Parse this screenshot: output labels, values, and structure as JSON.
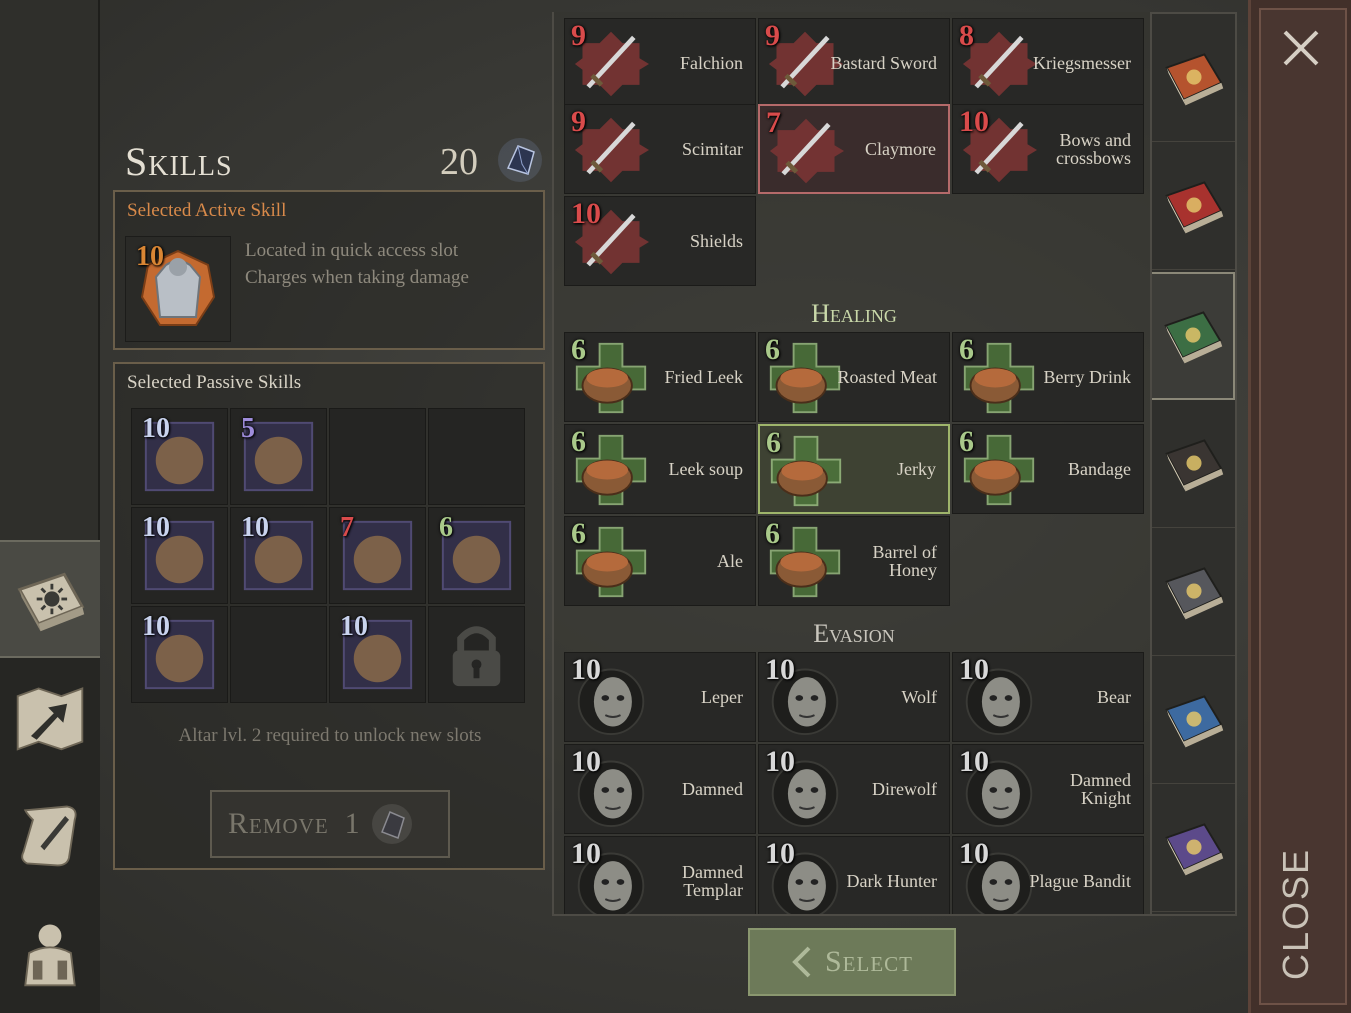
{
  "header": {
    "title": "Skills",
    "points": "20",
    "points_icon": "crystal-gem-icon"
  },
  "active_skill": {
    "title": "Selected Active Skill",
    "level": "10",
    "icon": "armor-torso-icon",
    "lines": [
      "Located in quick access slot",
      "Charges when taking damage"
    ]
  },
  "passive_skills": {
    "title": "Selected Passive Skills",
    "slots": [
      {
        "level": "10",
        "icon": "boot-speed-icon",
        "level_color": "#c9d3ee"
      },
      {
        "level": "5",
        "icon": "demon-shadow-icon",
        "level_color": "#9f8ddc"
      },
      {
        "level": "",
        "icon": "",
        "level_color": ""
      },
      {
        "level": "",
        "icon": "",
        "level_color": ""
      },
      {
        "level": "10",
        "icon": "red-cross-icon",
        "level_color": "#c9d3ee"
      },
      {
        "level": "10",
        "icon": "treasure-map-icon",
        "level_color": "#c9d3ee"
      },
      {
        "level": "7",
        "icon": "claymore-icon",
        "level_color": "#d94b4b"
      },
      {
        "level": "6",
        "icon": "jerky-icon",
        "level_color": "#a9c98a"
      },
      {
        "level": "10",
        "icon": "poison-skull-drop-icon",
        "level_color": "#c9d3ee"
      },
      {
        "level": "",
        "icon": "",
        "level_color": ""
      },
      {
        "level": "10",
        "icon": "chest-armor-icon",
        "level_color": "#c9d3ee"
      },
      {
        "level": "",
        "icon": "padlock-icon",
        "level_color": ""
      }
    ],
    "altar_note": "Altar lvl. 2 required to unlock new slots",
    "remove_label": "Remove",
    "remove_count": "1"
  },
  "weapons": [
    {
      "level": "9",
      "name": "Falchion",
      "icon": "falchion-icon"
    },
    {
      "level": "9",
      "name": "Bastard Sword",
      "icon": "bastard-sword-icon"
    },
    {
      "level": "8",
      "name": "Kriegsmesser",
      "icon": "kriegsmesser-icon"
    },
    {
      "level": "9",
      "name": "Scimitar",
      "icon": "scimitar-icon"
    },
    {
      "level": "7",
      "name": "Claymore",
      "icon": "claymore-icon",
      "selected": true
    },
    {
      "level": "10",
      "name": "Bows and crossbows",
      "icon": "bow-arrows-icon"
    },
    {
      "level": "10",
      "name": "Shields",
      "icon": "shield-icon"
    }
  ],
  "healing": {
    "title": "Healing",
    "items": [
      {
        "level": "6",
        "name": "Fried Leek",
        "icon": "fried-leek-icon"
      },
      {
        "level": "6",
        "name": "Roasted Meat",
        "icon": "roasted-meat-icon"
      },
      {
        "level": "6",
        "name": "Berry Drink",
        "icon": "berry-drink-icon"
      },
      {
        "level": "6",
        "name": "Leek soup",
        "icon": "leek-soup-icon"
      },
      {
        "level": "6",
        "name": "Jerky",
        "icon": "jerky-icon",
        "selected": true
      },
      {
        "level": "6",
        "name": "Bandage",
        "icon": "bandage-icon"
      },
      {
        "level": "6",
        "name": "Ale",
        "icon": "ale-mug-icon"
      },
      {
        "level": "6",
        "name": "Barrel of Honey",
        "icon": "honey-barrel-icon"
      }
    ]
  },
  "evasion": {
    "title": "Evasion",
    "items": [
      {
        "level": "10",
        "name": "Leper",
        "icon": "leper-face-icon"
      },
      {
        "level": "10",
        "name": "Wolf",
        "icon": "wolf-icon"
      },
      {
        "level": "10",
        "name": "Bear",
        "icon": "bear-icon"
      },
      {
        "level": "10",
        "name": "Damned",
        "icon": "damned-face-icon"
      },
      {
        "level": "10",
        "name": "Direwolf",
        "icon": "direwolf-icon"
      },
      {
        "level": "10",
        "name": "Damned Knight",
        "icon": "damned-knight-icon"
      },
      {
        "level": "10",
        "name": "Damned Templar",
        "icon": "damned-templar-icon"
      },
      {
        "level": "10",
        "name": "Dark Hunter",
        "icon": "dark-hunter-icon"
      },
      {
        "level": "10",
        "name": "Plague Bandit",
        "icon": "plague-bandit-icon"
      }
    ]
  },
  "buttons": {
    "select_label": "Select",
    "close_label": "CLOSE"
  },
  "nav": {
    "left": [
      "skills-book-icon",
      "map-arrow-icon",
      "quest-scroll-icon",
      "character-backpack-icon"
    ],
    "tabs": [
      "sun-book-icon",
      "sword-book-icon",
      "healing-book-icon",
      "mask-book-icon",
      "tools-book-icon",
      "shield-book-icon",
      "magic-book-icon"
    ]
  },
  "colors": {
    "weapon_level": "#d94b4b",
    "healing_level": "#a9c98a",
    "evasion_level": "#d8d8d8",
    "healing_title": "#c9d8a9",
    "evasion_title": "#c9c6bd",
    "active_title": "#d98a4a"
  }
}
